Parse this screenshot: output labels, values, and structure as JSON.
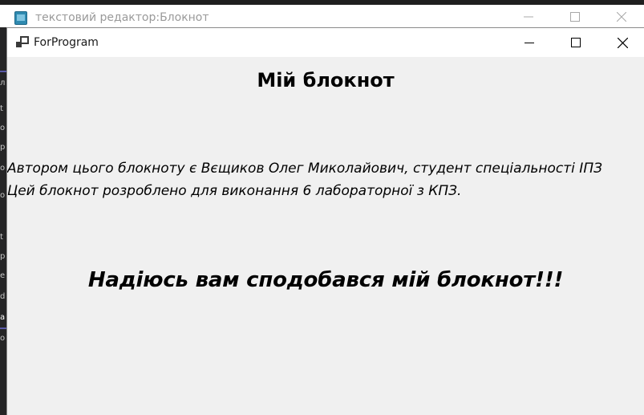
{
  "background_window": {
    "title": "текстовий редактор:Блокнот"
  },
  "window": {
    "title": "ForProgram",
    "controls": {
      "minimize": "─",
      "maximize": "☐",
      "close": "✕"
    }
  },
  "content": {
    "heading": "Мій блокнот",
    "line1": "Автором цього блокноту є  Вєщиков Олег Миколайович, студент спеціальності ІПЗ",
    "line2": "Цей блокнот розроблено для виконання 6 лабораторної з КПЗ.",
    "closing": "Надіюсь вам сподобався мій блокнот!!!"
  },
  "side_glyphs": [
    "л",
    "t",
    "o",
    "р",
    "o",
    "o",
    "t",
    "р",
    "e",
    "d",
    "a",
    "o"
  ],
  "colors": {
    "window_bg": "#f0f0f0",
    "titlebar_bg": "#ffffff",
    "text": "#000000",
    "background_app": "#1e1e1e"
  }
}
